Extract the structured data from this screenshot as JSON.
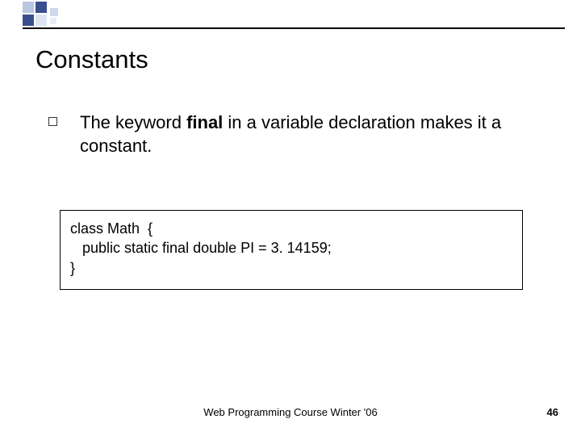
{
  "slide": {
    "title": "Constants",
    "bullet": {
      "pre": " The keyword ",
      "bold": "final",
      "post": " in a variable declaration makes it a constant."
    },
    "code": {
      "l1": "class Math  {",
      "l2": "   public static final double PI = 3. 14159;",
      "l3": "}"
    },
    "footer": "Web Programming Course Winter '06",
    "page": "46"
  }
}
